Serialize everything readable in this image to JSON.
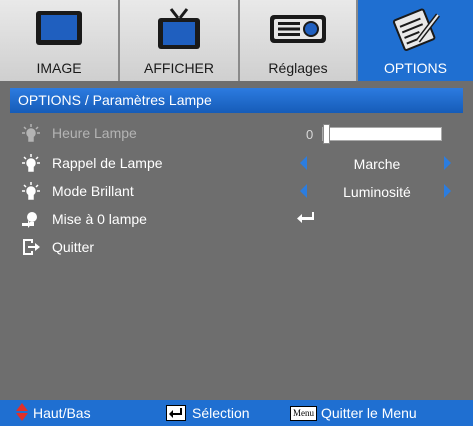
{
  "tabs": [
    {
      "label": "IMAGE",
      "icon": "monitor-icon",
      "active": false
    },
    {
      "label": "AFFICHER",
      "icon": "tv-icon",
      "active": false
    },
    {
      "label": "Réglages",
      "icon": "projector-icon",
      "active": false
    },
    {
      "label": "OPTIONS",
      "icon": "notepad-icon",
      "active": true
    }
  ],
  "breadcrumb": "OPTIONS / Paramètres Lampe",
  "items": [
    {
      "label": "Heure Lampe",
      "icon": "lamp-icon",
      "enabled": false,
      "value": "0",
      "slider_fraction": 0.0
    },
    {
      "label": "Rappel de Lampe",
      "icon": "lamp-icon",
      "enabled": true,
      "value": "Marche"
    },
    {
      "label": "Mode Brillant",
      "icon": "lamp-icon",
      "enabled": true,
      "value": "Luminosité"
    },
    {
      "label": "Mise à 0 lampe",
      "icon": "lamp-reset-icon",
      "enabled": true,
      "value_icon": "enter-icon"
    },
    {
      "label": "Quitter",
      "icon": "exit-icon",
      "enabled": true
    }
  ],
  "footer": {
    "nav": "Haut/Bas",
    "select": "Sélection",
    "menu_key": "Menu",
    "exit": "Quitter le Menu"
  },
  "colors": {
    "accent": "#1f6fd1",
    "background": "#6e6e6e",
    "arrow": "#2b7de0"
  }
}
